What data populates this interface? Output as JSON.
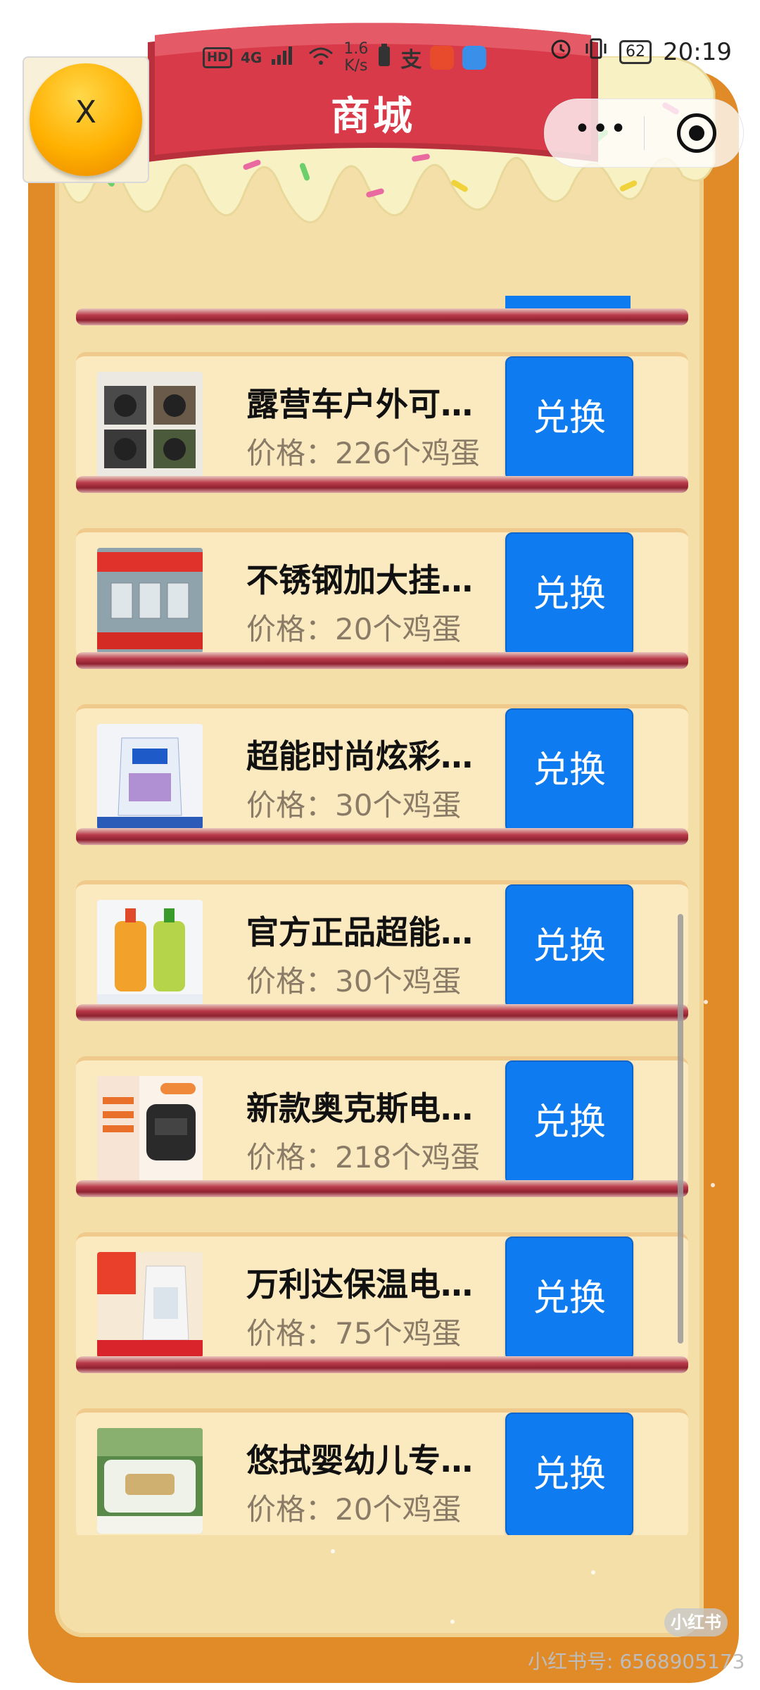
{
  "status_bar": {
    "hd": "HD",
    "network": "4G",
    "speed_value": "1.6",
    "speed_unit": "K/s",
    "battery": "62",
    "time": "20:19"
  },
  "header": {
    "title": "商城",
    "close_label": "X",
    "more_label": "•••"
  },
  "colors": {
    "frame": "#e08a28",
    "panel": "#f5dfa8",
    "ribbon": "#d83a49",
    "button": "#0f7bf0"
  },
  "products": [
    {
      "name": "露营车户外可…",
      "price": "价格：226个鸡蛋",
      "button": "兑换",
      "thumb_icon": "camping-wheels-image"
    },
    {
      "name": "不锈钢加大挂…",
      "price": "价格：20个鸡蛋",
      "button": "兑换",
      "thumb_icon": "steel-hooks-image"
    },
    {
      "name": "超能时尚炫彩…",
      "price": "价格：30个鸡蛋",
      "button": "兑换",
      "thumb_icon": "detergent-bag-image"
    },
    {
      "name": "官方正品超能…",
      "price": "价格：30个鸡蛋",
      "button": "兑换",
      "thumb_icon": "dish-soap-bottles-image"
    },
    {
      "name": "新款奥克斯电…",
      "price": "价格：218个鸡蛋",
      "button": "兑换",
      "thumb_icon": "rice-cooker-image"
    },
    {
      "name": "万利达保温电…",
      "price": "价格：75个鸡蛋",
      "button": "兑换",
      "thumb_icon": "electric-kettle-image"
    },
    {
      "name": "悠拭婴幼儿专…",
      "price": "价格：20个鸡蛋",
      "button": "兑换",
      "thumb_icon": "baby-wipes-image"
    }
  ],
  "watermark": {
    "badge": "小红书",
    "text": "小红书号: 6568905173"
  }
}
